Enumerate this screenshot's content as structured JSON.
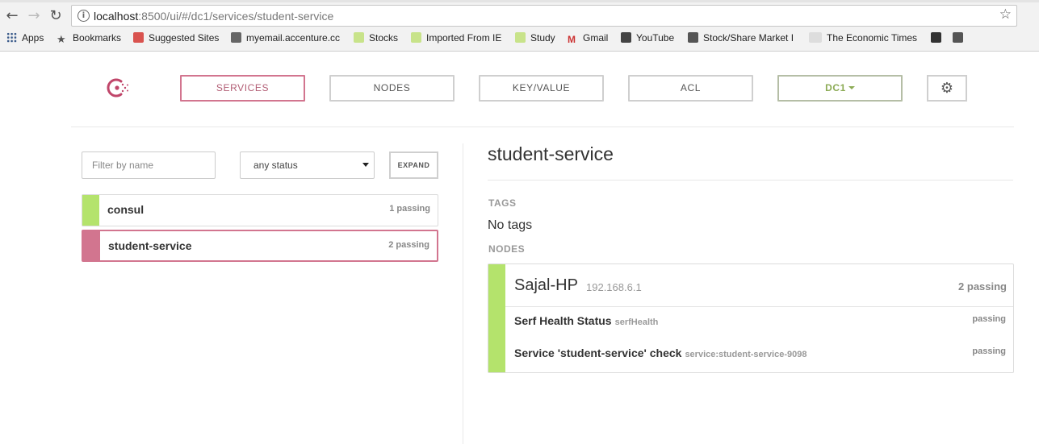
{
  "browser": {
    "url_host": "localhost",
    "url_rest": ":8500/ui/#/dc1/services/student-service",
    "bookmarks": [
      {
        "label": "Apps",
        "icon": "apps-grid-icon"
      },
      {
        "label": "Bookmarks",
        "icon": "star-icon"
      },
      {
        "label": "Suggested Sites",
        "icon": "suggested-sites-icon"
      },
      {
        "label": "myemail.accenture.cc",
        "icon": "accenture-icon"
      },
      {
        "label": "Stocks",
        "icon": "folder-icon"
      },
      {
        "label": "Imported From IE",
        "icon": "folder-icon"
      },
      {
        "label": "Study",
        "icon": "folder-icon"
      },
      {
        "label": "Gmail",
        "icon": "gmail-icon"
      },
      {
        "label": "YouTube",
        "icon": "youtube-icon"
      },
      {
        "label": "Stock/Share Market I",
        "icon": "stock-market-icon"
      },
      {
        "label": "The Economic Times",
        "icon": "economic-times-icon"
      }
    ]
  },
  "nav": {
    "services": "SERVICES",
    "nodes": "NODES",
    "keyvalue": "KEY/VALUE",
    "acl": "ACL",
    "datacenter": "DC1"
  },
  "filters": {
    "name_placeholder": "Filter by name",
    "status_selected": "any status",
    "expand_label": "EXPAND"
  },
  "services": [
    {
      "name": "consul",
      "count": "1 passing",
      "selected": false
    },
    {
      "name": "student-service",
      "count": "2 passing",
      "selected": true
    }
  ],
  "detail": {
    "title": "student-service",
    "tags_label": "TAGS",
    "tags_value": "No tags",
    "nodes_label": "NODES",
    "node": {
      "name": "Sajal-HP",
      "ip": "192.168.6.1",
      "count": "2 passing",
      "checks": [
        {
          "name": "Serf Health Status",
          "id": "serfHealth",
          "status": "passing"
        },
        {
          "name": "Service 'student-service' check",
          "id": "service:student-service-9098",
          "status": "passing"
        }
      ]
    }
  },
  "colors": {
    "accent": "#d2758f",
    "passing": "#b4e36c",
    "datacenter": "#8cab55"
  }
}
